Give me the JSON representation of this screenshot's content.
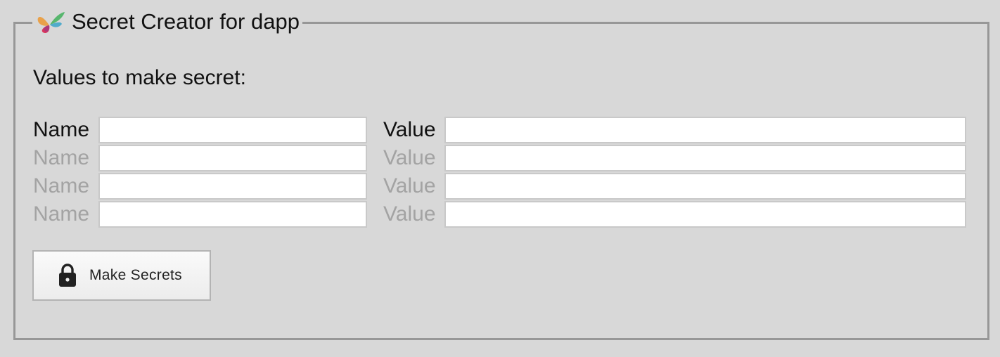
{
  "panel": {
    "title": "Secret Creator for dapp",
    "logo_icon": "butterfly-logo-icon",
    "intro": "Values to make secret:"
  },
  "rows": [
    {
      "name_label": "Name",
      "value_label": "Value",
      "name_value": "",
      "value_value": ""
    },
    {
      "name_label": "Name",
      "value_label": "Value",
      "name_value": "",
      "value_value": ""
    },
    {
      "name_label": "Name",
      "value_label": "Value",
      "name_value": "",
      "value_value": ""
    },
    {
      "name_label": "Name",
      "value_label": "Value",
      "name_value": "",
      "value_value": ""
    }
  ],
  "actions": {
    "make_secrets_label": "Make Secrets",
    "make_secrets_icon": "lock-icon"
  },
  "colors": {
    "background": "#d8d8d8",
    "frame_border": "#979797",
    "inactive_label": "#a3a3a3"
  }
}
